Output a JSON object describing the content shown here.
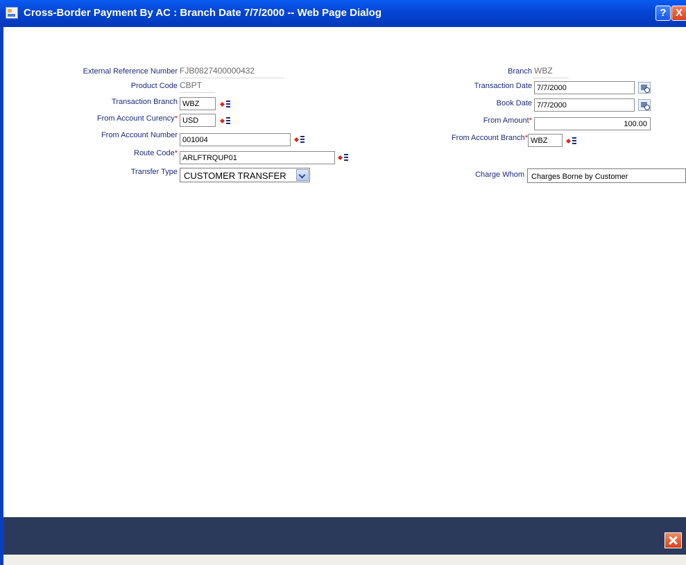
{
  "window": {
    "title": "Cross-Border Payment By AC : Branch Date 7/7/2000 -- Web Page Dialog",
    "help_label": "?",
    "close_label": "X"
  },
  "form": {
    "external_reference_number": {
      "label": "External Reference Number",
      "value": "FJB0827400000432"
    },
    "product_code": {
      "label": "Product Code",
      "value": "CBPT"
    },
    "transaction_branch": {
      "label": "Transaction Branch",
      "value": "WBZ"
    },
    "from_account_currency": {
      "label": "From Account Curency",
      "value": "USD"
    },
    "from_account_number": {
      "label": "From Account Number",
      "value": "001004"
    },
    "route_code": {
      "label": "Route Code",
      "value": "ARLFTRQUP01"
    },
    "transfer_type": {
      "label": "Transfer Type",
      "value": "CUSTOMER TRANSFER"
    },
    "branch": {
      "label": "Branch",
      "value": "WBZ"
    },
    "transaction_date": {
      "label": "Transaction Date",
      "value": "7/7/2000"
    },
    "book_date": {
      "label": "Book Date",
      "value": "7/7/2000"
    },
    "from_amount": {
      "label": "From Amount",
      "value": "100.00"
    },
    "from_account_branch": {
      "label": "From Account Branch",
      "value": "WBZ"
    },
    "charge_whom": {
      "label": "Charge Whom",
      "value": "Charges Borne by Customer"
    },
    "required_marker": "*"
  },
  "colors": {
    "titlebar": "#0447d6",
    "label_text": "#1a2a7a",
    "required": "#d01010",
    "footer": "#2b3a5a"
  }
}
